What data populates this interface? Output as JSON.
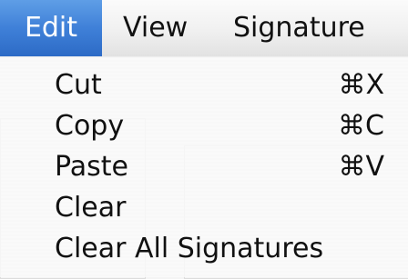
{
  "menubar": {
    "items": [
      {
        "label": "Edit"
      },
      {
        "label": "View"
      },
      {
        "label": "Signature"
      }
    ],
    "active_color": "#3f80d8"
  },
  "menu": {
    "items": [
      {
        "label": "Cut",
        "shortcut": "⌘X"
      },
      {
        "label": "Copy",
        "shortcut": "⌘C"
      },
      {
        "label": "Paste",
        "shortcut": "⌘V"
      },
      {
        "label": "Clear",
        "shortcut": ""
      },
      {
        "label": "Clear All Signatures",
        "shortcut": ""
      }
    ]
  }
}
